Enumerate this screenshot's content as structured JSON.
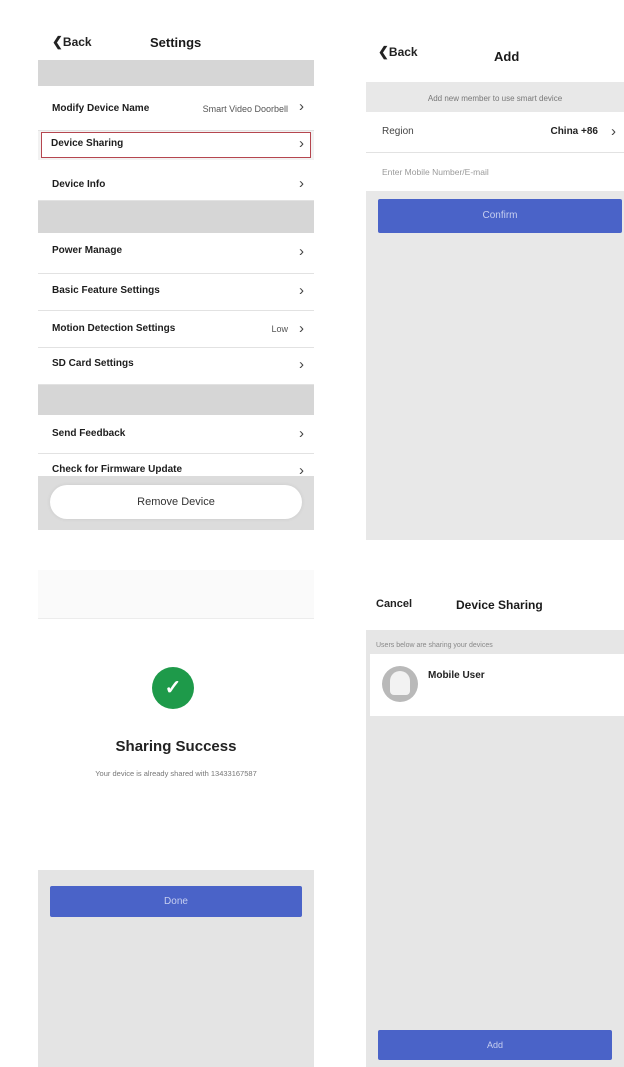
{
  "settings": {
    "back": "Back",
    "title": "Settings",
    "items": [
      {
        "label": "Modify Device Name",
        "value": "Smart Video Doorbell"
      },
      {
        "label": "Device Sharing",
        "value": ""
      },
      {
        "label": "Device Info",
        "value": ""
      },
      {
        "label": "Power Manage",
        "value": ""
      },
      {
        "label": "Basic Feature Settings",
        "value": ""
      },
      {
        "label": "Motion Detection Settings",
        "value": "Low"
      },
      {
        "label": "SD Card Settings",
        "value": ""
      },
      {
        "label": "Send Feedback",
        "value": ""
      },
      {
        "label": "Check for Firmware Update",
        "value": ""
      }
    ],
    "remove_button": "Remove Device",
    "chevron": "›"
  },
  "add": {
    "back": "Back",
    "title": "Add",
    "hint": "Add new member to use smart device",
    "region_label": "Region",
    "region_value": "China +86",
    "mobile_placeholder": "Enter Mobile Number/E-mail",
    "confirm_button": "Confirm"
  },
  "success": {
    "title": "Sharing Success",
    "message": "Your device is already shared with 13433167587",
    "done_button": "Done",
    "check": "✓"
  },
  "sharing": {
    "cancel": "Cancel",
    "title": "Device Sharing",
    "note": "Users below are sharing your devices",
    "user_name": "Mobile User",
    "add_button": "Add"
  },
  "colors": {
    "accent_blue": "#4a63c8",
    "success_green": "#1e9a4a",
    "section_gray": "#d6d6d6"
  }
}
